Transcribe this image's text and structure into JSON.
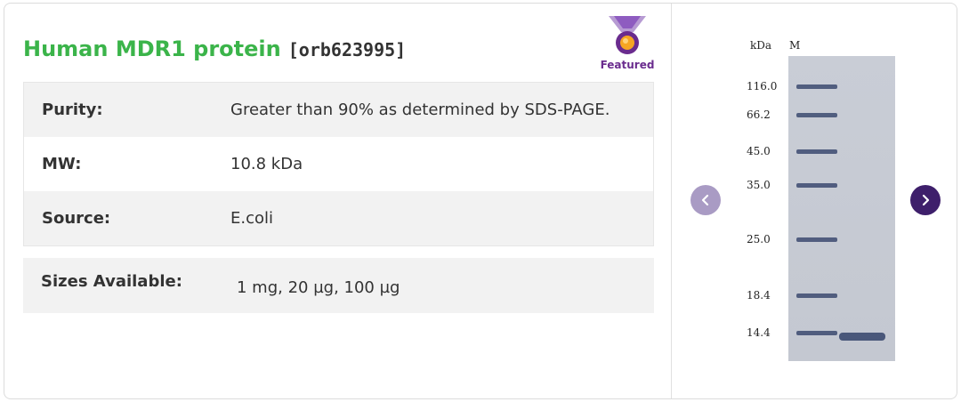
{
  "product": {
    "title": "Human MDR1 protein",
    "sku": "[orb623995]",
    "badge": "Featured"
  },
  "specs": [
    {
      "label": "Purity:",
      "value": "Greater than 90% as determined by SDS-PAGE."
    },
    {
      "label": "MW:",
      "value": "10.8 kDa"
    },
    {
      "label": "Source:",
      "value": "E.coli"
    }
  ],
  "sizes": {
    "label": "Sizes Available:",
    "value": "1 mg, 20 µg, 100 µg"
  },
  "gel": {
    "unit_label": "kDa",
    "lane_label": "M",
    "markers": [
      "116.0",
      "66.2",
      "45.0",
      "35.0",
      "25.0",
      "18.4",
      "14.4"
    ]
  },
  "carousel": {
    "prev_icon": "chevron-left-icon",
    "next_icon": "chevron-right-icon"
  },
  "colors": {
    "title": "#3bb44a",
    "badge": "#6a2c8e",
    "next_button": "#3e1f6b",
    "prev_button": "#a99bc4"
  }
}
